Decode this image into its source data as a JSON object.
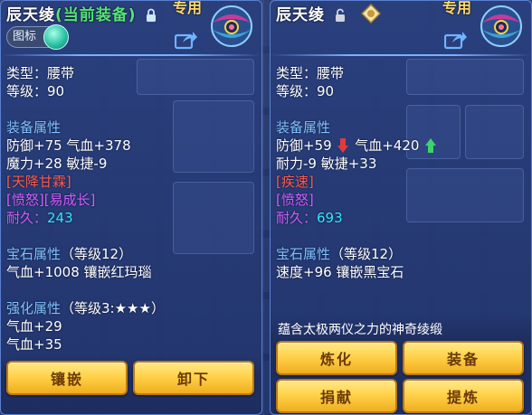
{
  "left_panel": {
    "title_name": "辰天绫",
    "title_status": "(当前装备)",
    "special_tag": "专用",
    "icon_toggle_label": "图标",
    "type_line": "类型：腰带",
    "level_line": "等级：90",
    "equip_attr_heading": "装备属性",
    "attr_line1": "防御+75 气血+378",
    "attr_line2": "魔力+28 敏捷-9",
    "special_skill": "[天降甘霖]",
    "special_effects": "[愤怒][易成长]",
    "durability_label": "耐久：",
    "durability_value": "243",
    "gem_heading": "宝石属性",
    "gem_level": "（等级12）",
    "gem_line": "气血+1008 镶嵌红玛瑙",
    "enhance_heading": "强化属性",
    "enhance_level": "（等级3:★★★）",
    "enhance_line1": "气血+29",
    "enhance_line2": "气血+35",
    "buttons": {
      "inlay": "镶嵌",
      "unequip": "卸下"
    }
  },
  "right_panel": {
    "title_name": "辰天绫",
    "special_tag": "专用",
    "type_line": "类型：腰带",
    "level_line": "等级：90",
    "equip_attr_heading": "装备属性",
    "attr_line1_a": "防御+59",
    "attr_line1_b": "气血+420",
    "attr_line2": "耐力-9 敏捷+33",
    "special_skill": "[疾速]",
    "special_effects": "[愤怒]",
    "durability_label": "耐久：",
    "durability_value": "693",
    "gem_heading": "宝石属性",
    "gem_level": "（等级12）",
    "gem_line": "速度+96 镶嵌黑宝石",
    "description": "蕴含太极两仪之力的神奇绫缎",
    "buttons": {
      "refine": "炼化",
      "equip": "装备",
      "donate": "捐献",
      "extract": "提炼"
    }
  },
  "colors": {
    "section_heading": "#7fc2ff",
    "special_skill": "#ff5a4e",
    "special_effect": "#d45cff",
    "durability": "#34e6ff",
    "current_equipped": "#55e27a",
    "button_gold": "#ffd24a",
    "stat_down": "#e23b3b",
    "stat_up": "#3bd46a"
  },
  "icons": [
    "lock-icon",
    "unlock-icon",
    "badge-icon",
    "share-icon",
    "belt-item-icon",
    "down-arrow-icon",
    "up-arrow-icon"
  ]
}
